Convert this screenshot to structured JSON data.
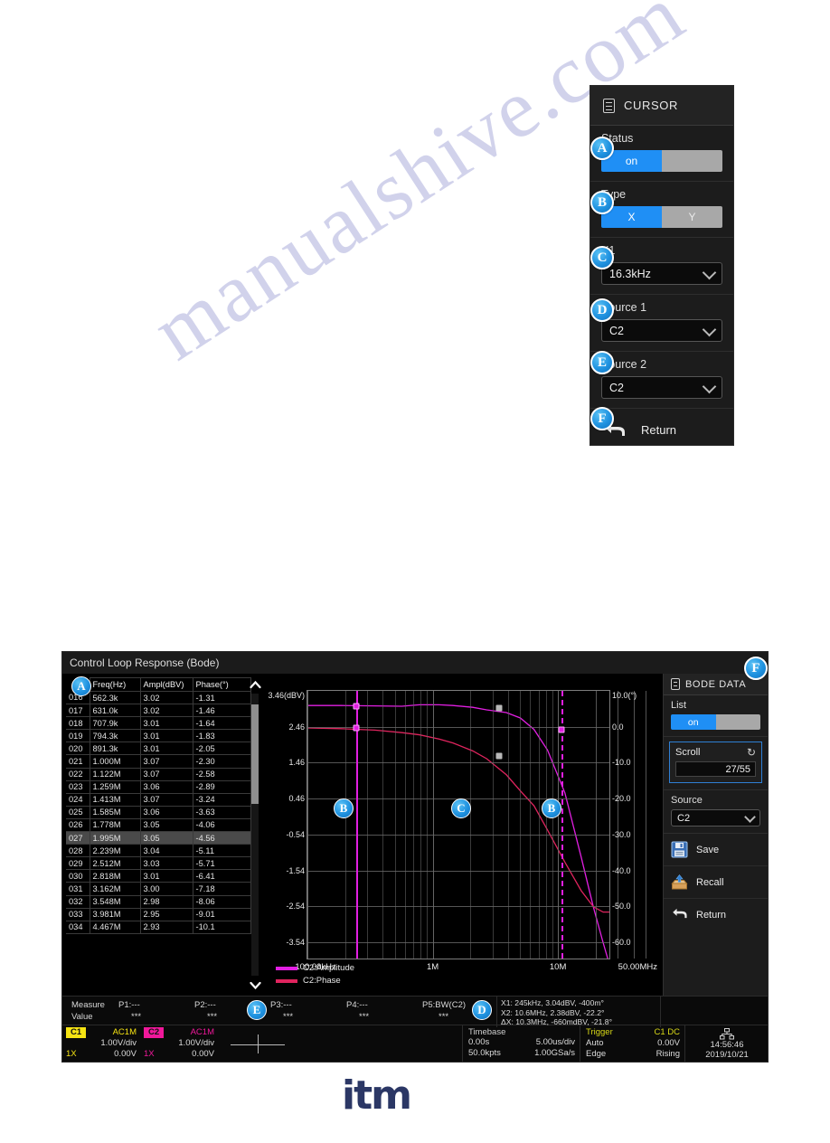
{
  "watermark": {
    "text": "manualshive.com"
  },
  "brand": {
    "logo_text": "itm"
  },
  "cursor_menu": {
    "title": "CURSOR",
    "title_icon": "document-icon",
    "status": {
      "label": "Status",
      "on_label": "on",
      "off_label": ""
    },
    "type": {
      "label": "Type",
      "x_label": "X",
      "y_label": "Y"
    },
    "x1": {
      "label": "X1",
      "value": "16.3kHz"
    },
    "source1": {
      "label": "Source 1",
      "value": "C2"
    },
    "source2": {
      "label": "Source 2",
      "value": "C2"
    },
    "return": {
      "label": "Return",
      "icon": "back-arrow-icon"
    },
    "callouts": {
      "a": "A",
      "b": "B",
      "c": "C",
      "d": "D",
      "e": "E",
      "f": "F"
    }
  },
  "scope": {
    "title": "Control Loop Response (Bode)",
    "table": {
      "callout": "A",
      "headers": [
        "",
        "Freq(Hz)",
        "Ampl(dBV)",
        "Phase(°)"
      ],
      "selected_index": "027",
      "rows": [
        {
          "idx": "016",
          "freq": "562.3k",
          "ampl": "3.02",
          "phase": "-1.31"
        },
        {
          "idx": "017",
          "freq": "631.0k",
          "ampl": "3.02",
          "phase": "-1.46"
        },
        {
          "idx": "018",
          "freq": "707.9k",
          "ampl": "3.01",
          "phase": "-1.64"
        },
        {
          "idx": "019",
          "freq": "794.3k",
          "ampl": "3.01",
          "phase": "-1.83"
        },
        {
          "idx": "020",
          "freq": "891.3k",
          "ampl": "3.01",
          "phase": "-2.05"
        },
        {
          "idx": "021",
          "freq": "1.000M",
          "ampl": "3.07",
          "phase": "-2.30"
        },
        {
          "idx": "022",
          "freq": "1.122M",
          "ampl": "3.07",
          "phase": "-2.58"
        },
        {
          "idx": "023",
          "freq": "1.259M",
          "ampl": "3.06",
          "phase": "-2.89"
        },
        {
          "idx": "024",
          "freq": "1.413M",
          "ampl": "3.07",
          "phase": "-3.24"
        },
        {
          "idx": "025",
          "freq": "1.585M",
          "ampl": "3.06",
          "phase": "-3.63"
        },
        {
          "idx": "026",
          "freq": "1.778M",
          "ampl": "3.05",
          "phase": "-4.06"
        },
        {
          "idx": "027",
          "freq": "1.995M",
          "ampl": "3.05",
          "phase": "-4.56"
        },
        {
          "idx": "028",
          "freq": "2.239M",
          "ampl": "3.04",
          "phase": "-5.11"
        },
        {
          "idx": "029",
          "freq": "2.512M",
          "ampl": "3.03",
          "phase": "-5.71"
        },
        {
          "idx": "030",
          "freq": "2.818M",
          "ampl": "3.01",
          "phase": "-6.41"
        },
        {
          "idx": "031",
          "freq": "3.162M",
          "ampl": "3.00",
          "phase": "-7.18"
        },
        {
          "idx": "032",
          "freq": "3.548M",
          "ampl": "2.98",
          "phase": "-8.06"
        },
        {
          "idx": "033",
          "freq": "3.981M",
          "ampl": "2.95",
          "phase": "-9.01"
        },
        {
          "idx": "034",
          "freq": "4.467M",
          "ampl": "2.93",
          "phase": "-10.1"
        }
      ]
    },
    "plot_callouts": {
      "left_b": "B",
      "center_c": "C",
      "right_b": "B"
    },
    "bode_menu": {
      "title": "BODE DATA",
      "title_icon": "document-icon",
      "list": {
        "label": "List",
        "on_label": "on",
        "off_label": ""
      },
      "scroll": {
        "label": "Scroll",
        "value": "27/55",
        "icon": "refresh-icon"
      },
      "source": {
        "label": "Source",
        "value": "C2"
      },
      "save": {
        "label": "Save",
        "icon": "floppy-disk-icon"
      },
      "recall": {
        "label": "Recall",
        "icon": "recall-icon"
      },
      "return": {
        "label": "Return",
        "icon": "back-arrow-icon"
      }
    },
    "measure": {
      "row1_label": "Measure",
      "row2_label": "Value",
      "callout": "E",
      "items": [
        {
          "name": "P1:---",
          "value": "***"
        },
        {
          "name": "P2:---",
          "value": "***"
        },
        {
          "name": "P3:---",
          "value": "***"
        },
        {
          "name": "P4:---",
          "value": "***"
        },
        {
          "name": "P5:BW(C2)",
          "value": "***"
        }
      ]
    },
    "cursor_readout": {
      "callout": "D",
      "x1": "X1: 245kHz, 3.04dBV, -400m°",
      "x2": "X2: 10.6MHz, 2.38dBV, -22.2°",
      "dx": "ΔX: 10.3MHz, -660mdBV, -21.8°"
    },
    "status_bar": {
      "ch1": {
        "tag": "C1",
        "coupling": "AC1M",
        "scale": "1.00V/div",
        "offset": "0.00V",
        "probe": "1X"
      },
      "ch2": {
        "tag": "C2",
        "coupling": "AC1M",
        "scale": "1.00V/div",
        "offset": "0.00V",
        "probe": "1X"
      },
      "timebase": {
        "label": "Timebase",
        "delay": "0.00s",
        "scale": "5.00us/div",
        "points": "50.0kpts",
        "rate": "1.00GSa/s"
      },
      "trigger": {
        "label": "Trigger",
        "source": "C1 DC",
        "mode": "Auto",
        "level": "0.00V",
        "type": "Edge",
        "slope": "Rising"
      },
      "clock": {
        "time": "14:56:46",
        "date": "2019/10/21",
        "icon": "network-icon"
      }
    }
  },
  "chart_data": {
    "type": "line",
    "title": "Control Loop Response (Bode)",
    "xlabel": "",
    "ylabel": "dBV",
    "y2label": "°",
    "x_scale": "log",
    "xlim": [
      100000,
      50000000
    ],
    "x_tick_labels": [
      "100.00kHz",
      "1M",
      "10M",
      "50.00MHz"
    ],
    "x_tick_values": [
      100000,
      1000000,
      10000000,
      50000000
    ],
    "ylim_left": [
      -4.04,
      3.46
    ],
    "y_left_ticks": [
      "3.46(dBV)",
      "2.46",
      "1.46",
      "0.46",
      "-0.54",
      "-1.54",
      "-2.54",
      "-3.54"
    ],
    "y_left_values": [
      3.46,
      2.46,
      1.46,
      0.46,
      -0.54,
      -1.54,
      -2.54,
      -3.54
    ],
    "ylim_right": [
      -65,
      10
    ],
    "y_right_ticks": [
      "10.0(°)",
      "0.0",
      "-10.0",
      "-20.0",
      "-30.0",
      "-40.0",
      "-50.0",
      "-60.0"
    ],
    "y_right_values": [
      10.0,
      0.0,
      -10.0,
      -20.0,
      -30.0,
      -40.0,
      -50.0,
      -60.0
    ],
    "grid": true,
    "legend_position": "bottom-left",
    "series": [
      {
        "name": "C2:Amplitude",
        "color": "#e21fe2",
        "axis": "left",
        "x": [
          100000,
          200000,
          400000,
          700000,
          1000000,
          1500000,
          2000000,
          3000000,
          4000000,
          6000000,
          8000000,
          10600000,
          14000000,
          20000000,
          28000000,
          36000000,
          44000000,
          50000000
        ],
        "y": [
          3.05,
          3.05,
          3.04,
          3.03,
          3.07,
          3.07,
          3.05,
          3.0,
          2.93,
          2.85,
          2.7,
          2.38,
          1.8,
          0.6,
          -1.2,
          -2.6,
          -3.6,
          -4.2
        ]
      },
      {
        "name": "C2:Phase",
        "color": "#e0245e",
        "axis": "right",
        "x": [
          100000,
          200000,
          400000,
          700000,
          1000000,
          1500000,
          2000000,
          3000000,
          4000000,
          6000000,
          8000000,
          10600000,
          14000000,
          20000000,
          28000000,
          36000000,
          44000000,
          50000000
        ],
        "y": [
          -0.4,
          -0.6,
          -1.0,
          -1.7,
          -2.3,
          -3.5,
          -4.6,
          -6.8,
          -9.0,
          -13.5,
          -18.0,
          -22.2,
          -29.0,
          -38.0,
          -46.0,
          -50.5,
          -52.0,
          -52.0
        ]
      }
    ],
    "cursors": [
      {
        "name": "X1",
        "x": 245000,
        "style": "solid",
        "color": "#e21fe2"
      },
      {
        "name": "X2",
        "x": 10600000,
        "style": "dashed",
        "color": "#e21fe2"
      }
    ],
    "annotations": [
      {
        "label": "X1",
        "text": "X1: 245kHz, 3.04dBV, -400m°"
      },
      {
        "label": "X2",
        "text": "X2: 10.6MHz, 2.38dBV, -22.2°"
      },
      {
        "label": "dX",
        "text": "ΔX: 10.3MHz, -660mdBV, -21.8°"
      }
    ]
  }
}
